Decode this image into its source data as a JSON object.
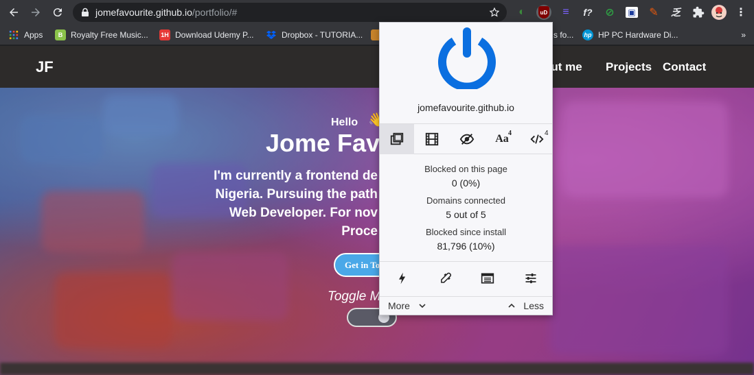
{
  "browser": {
    "url_host": "jomefavourite.github.io",
    "url_path": "/portfolio/#",
    "extensions": [
      {
        "name": "ext-translate",
        "glyph": "◐",
        "color": "#3c8a3c"
      },
      {
        "name": "ublock-origin",
        "glyph": "uD",
        "color": "#800000"
      },
      {
        "name": "ext-menu",
        "glyph": "≡",
        "color": "#7b61ff"
      },
      {
        "name": "ext-function",
        "glyph": "f?",
        "color": "#35363a"
      },
      {
        "name": "ext-colorpick",
        "glyph": "⊘",
        "color": "#2f9e44"
      },
      {
        "name": "ext-screen",
        "glyph": "▣",
        "color": "#ffffff"
      },
      {
        "name": "ext-clipper",
        "glyph": "✎",
        "color": "#e8590c"
      },
      {
        "name": "ext-font",
        "glyph": "乏",
        "color": "#35363a"
      }
    ]
  },
  "bookmarks": [
    {
      "label": "Apps",
      "icon": "apps-grid-icon",
      "color": "#4285f4"
    },
    {
      "label": "Royalty Free Music...",
      "icon": "B",
      "color": "#8bc34a"
    },
    {
      "label": "Download Udemy P...",
      "icon": "1H",
      "color": "#e53935"
    },
    {
      "label": "Dropbox - TUTORIA...",
      "icon": "dropbox-icon",
      "color": "#0061ff"
    },
    {
      "label": "s fo...",
      "icon": "",
      "color": "#35363a"
    },
    {
      "label": "HP PC Hardware Di...",
      "icon": "hp-logo-icon",
      "color": "#0096d6"
    }
  ],
  "site": {
    "brand": "JF",
    "nav": [
      "out me",
      "Projects",
      "Contact"
    ],
    "hello": "Hello",
    "headline": "Jome Fav",
    "intro_lines": [
      "I'm currently a frontend de",
      "Nigeria. Pursuing the path",
      "Web Developer. For nov",
      "Proce"
    ],
    "cta": "Get in To",
    "toggle_label": "Toggle M"
  },
  "popup": {
    "domain": "jomefavourite.github.io",
    "tool_badges": {
      "fonts": "4",
      "scripts": "4"
    },
    "fonts_label": "Aa",
    "blocked_page_label": "Blocked on this page",
    "blocked_page_value": "0 (0%)",
    "domains_label": "Domains connected",
    "domains_value": "5 out of 5",
    "blocked_install_label": "Blocked since install",
    "blocked_install_value": "81,796 (10%)",
    "more": "More",
    "less": "Less",
    "accent": "#0b6fe0"
  }
}
